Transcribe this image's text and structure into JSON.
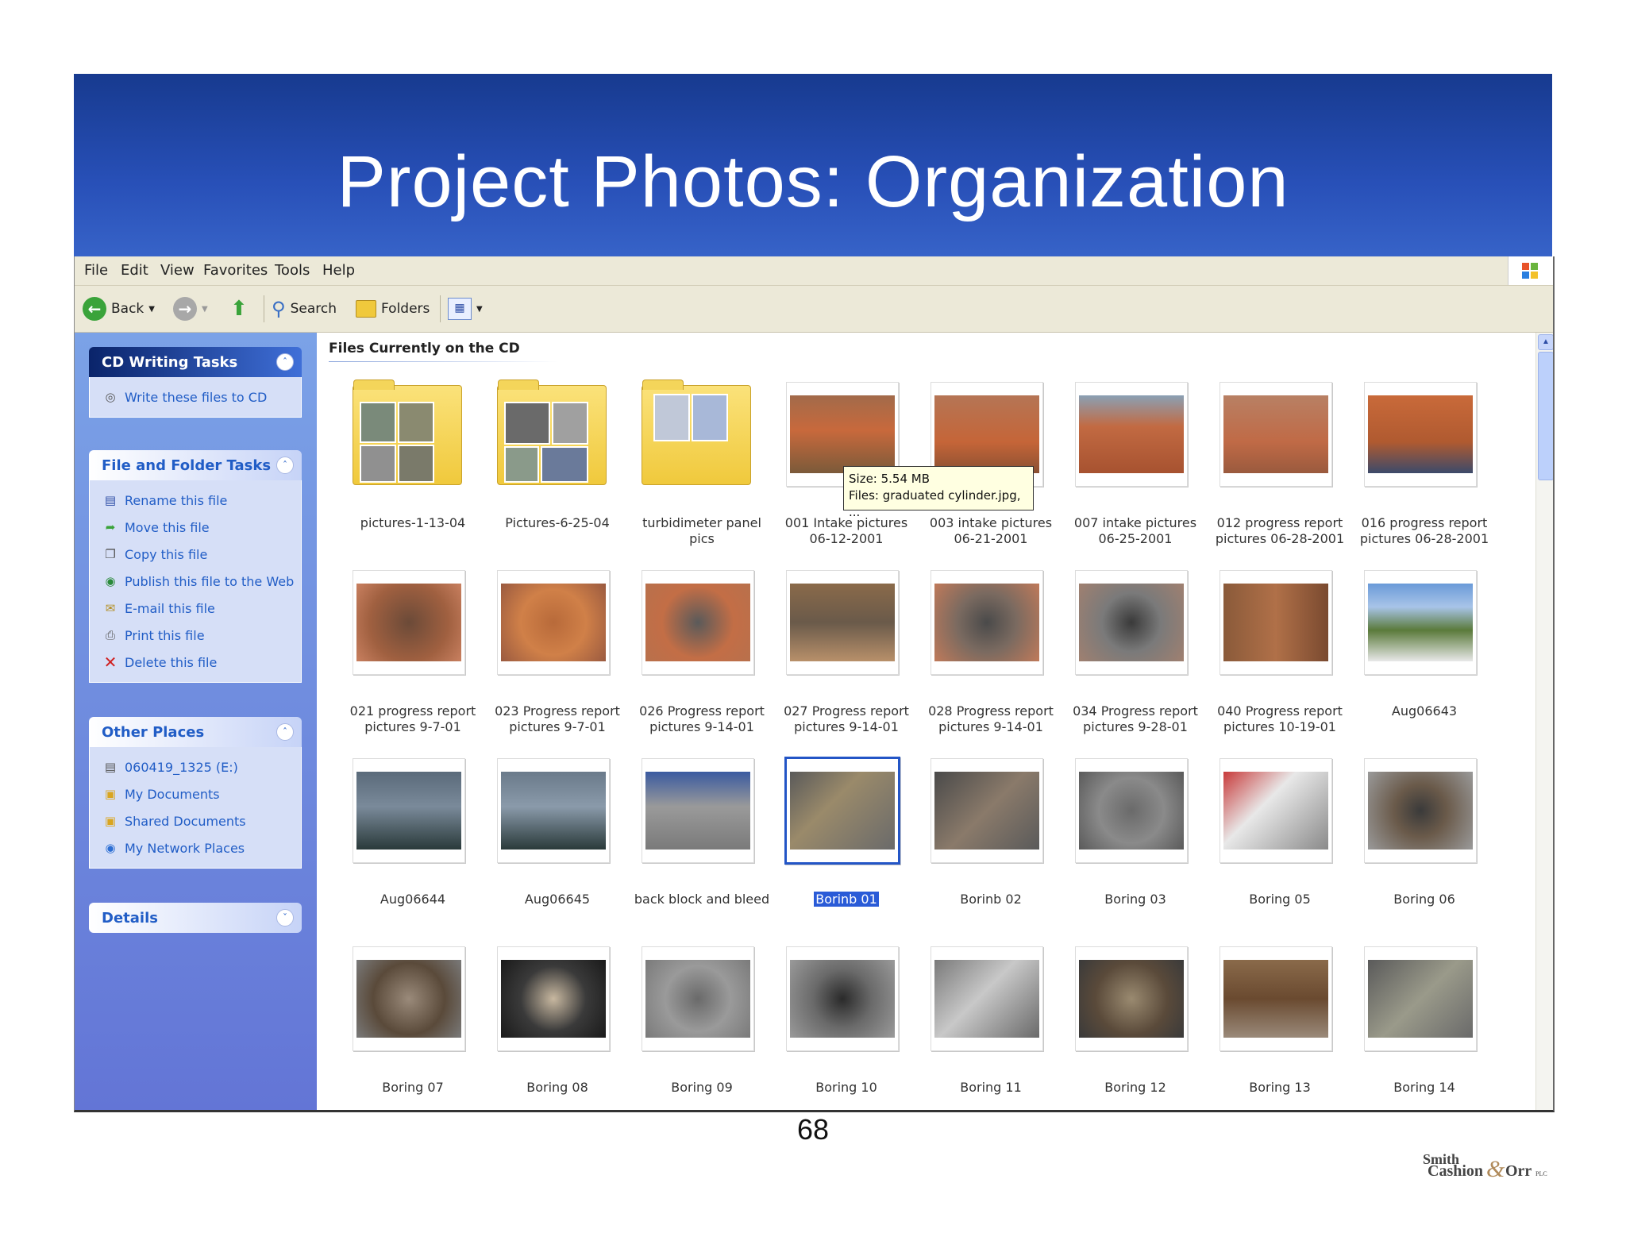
{
  "slide": {
    "title": "Project Photos: Organization",
    "page_number": "68"
  },
  "logo": {
    "line1": "Smith",
    "line2": "Cashion",
    "amp": "&",
    "line3": "Orr",
    "suffix": "PLC"
  },
  "menu": [
    "File",
    "Edit",
    "View",
    "Favorites",
    "Tools",
    "Help"
  ],
  "toolbar": {
    "back_label": "Back",
    "search_label": "Search",
    "folders_label": "Folders"
  },
  "panels": {
    "cd_writing": {
      "title": "CD Writing Tasks",
      "items": [
        "Write these files to CD"
      ]
    },
    "file_folder": {
      "title": "File and Folder Tasks",
      "items": [
        "Rename this file",
        "Move this file",
        "Copy this file",
        "Publish this file to the Web",
        "E-mail this file",
        "Print this file",
        "Delete this file"
      ]
    },
    "other_places": {
      "title": "Other Places",
      "items": [
        "060419_1325 (E:)",
        "My Documents",
        "Shared Documents",
        "My Network Places"
      ]
    },
    "details": {
      "title": "Details"
    }
  },
  "content": {
    "group_label": "Files Currently on the CD",
    "tooltip": {
      "size": "Size: 5.54 MB",
      "files": "Files: graduated cylinder.jpg, ..."
    },
    "files": [
      [
        "pictures-1-13-04"
      ],
      [
        "Pictures-6-25-04"
      ],
      [
        "turbidimeter panel pics"
      ],
      [
        "001 Intake pictures",
        "06-12-2001"
      ],
      [
        "003 intake pictures",
        "06-21-2001"
      ],
      [
        "007 intake pictures",
        "06-25-2001"
      ],
      [
        "012 progress report",
        "pictures 06-28-2001"
      ],
      [
        "016 progress report",
        "pictures 06-28-2001"
      ],
      [
        "021 progress report",
        "pictures 9-7-01"
      ],
      [
        "023 Progress report",
        "pictures 9-7-01"
      ],
      [
        "026 Progress report",
        "pictures 9-14-01"
      ],
      [
        "027 Progress report",
        "pictures 9-14-01"
      ],
      [
        "028 Progress report",
        "pictures 9-14-01"
      ],
      [
        "034 Progress report",
        "pictures 9-28-01"
      ],
      [
        "040 Progress report",
        "pictures 10-19-01"
      ],
      [
        "Aug06643"
      ],
      [
        "Aug06644"
      ],
      [
        "Aug06645"
      ],
      [
        "back block and bleed"
      ],
      [
        "Borinb 01"
      ],
      [
        "Borinb 02"
      ],
      [
        "Boring 03"
      ],
      [
        "Boring 05"
      ],
      [
        "Boring 06"
      ],
      [
        "Boring 07"
      ],
      [
        "Boring 08"
      ],
      [
        "Boring 09"
      ],
      [
        "Boring 10"
      ],
      [
        "Boring 11"
      ],
      [
        "Boring 12"
      ],
      [
        "Boring 13"
      ],
      [
        "Boring 14"
      ]
    ],
    "selected_index": 19
  },
  "colors": {
    "banner": "#2850b8",
    "task_pane": "#6f8ee0",
    "selection": "#2a5bd7",
    "dirt": "#b8603a",
    "steel": "#5a5a5a"
  }
}
